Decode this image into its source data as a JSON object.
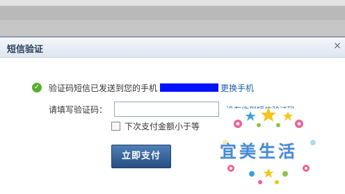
{
  "dialog": {
    "title": "短信验证",
    "close_glyph": "×",
    "sent_message": "验证码短信已发送到您的手机",
    "change_phone_link": "更换手机",
    "code_label": "请填写验证码：",
    "code_value": "",
    "resend_link": "没有收到短信验证码",
    "small_amount_option": "下次支付金额小于等",
    "pay_button": "立即支付"
  },
  "watermark": {
    "text": "宜美生活"
  },
  "colors": {
    "link": "#1d5da7",
    "button": "#2d5a8f",
    "mask": "#0012ff",
    "success": "#5aae2e"
  },
  "icons": {
    "success": "check-circle-icon"
  }
}
